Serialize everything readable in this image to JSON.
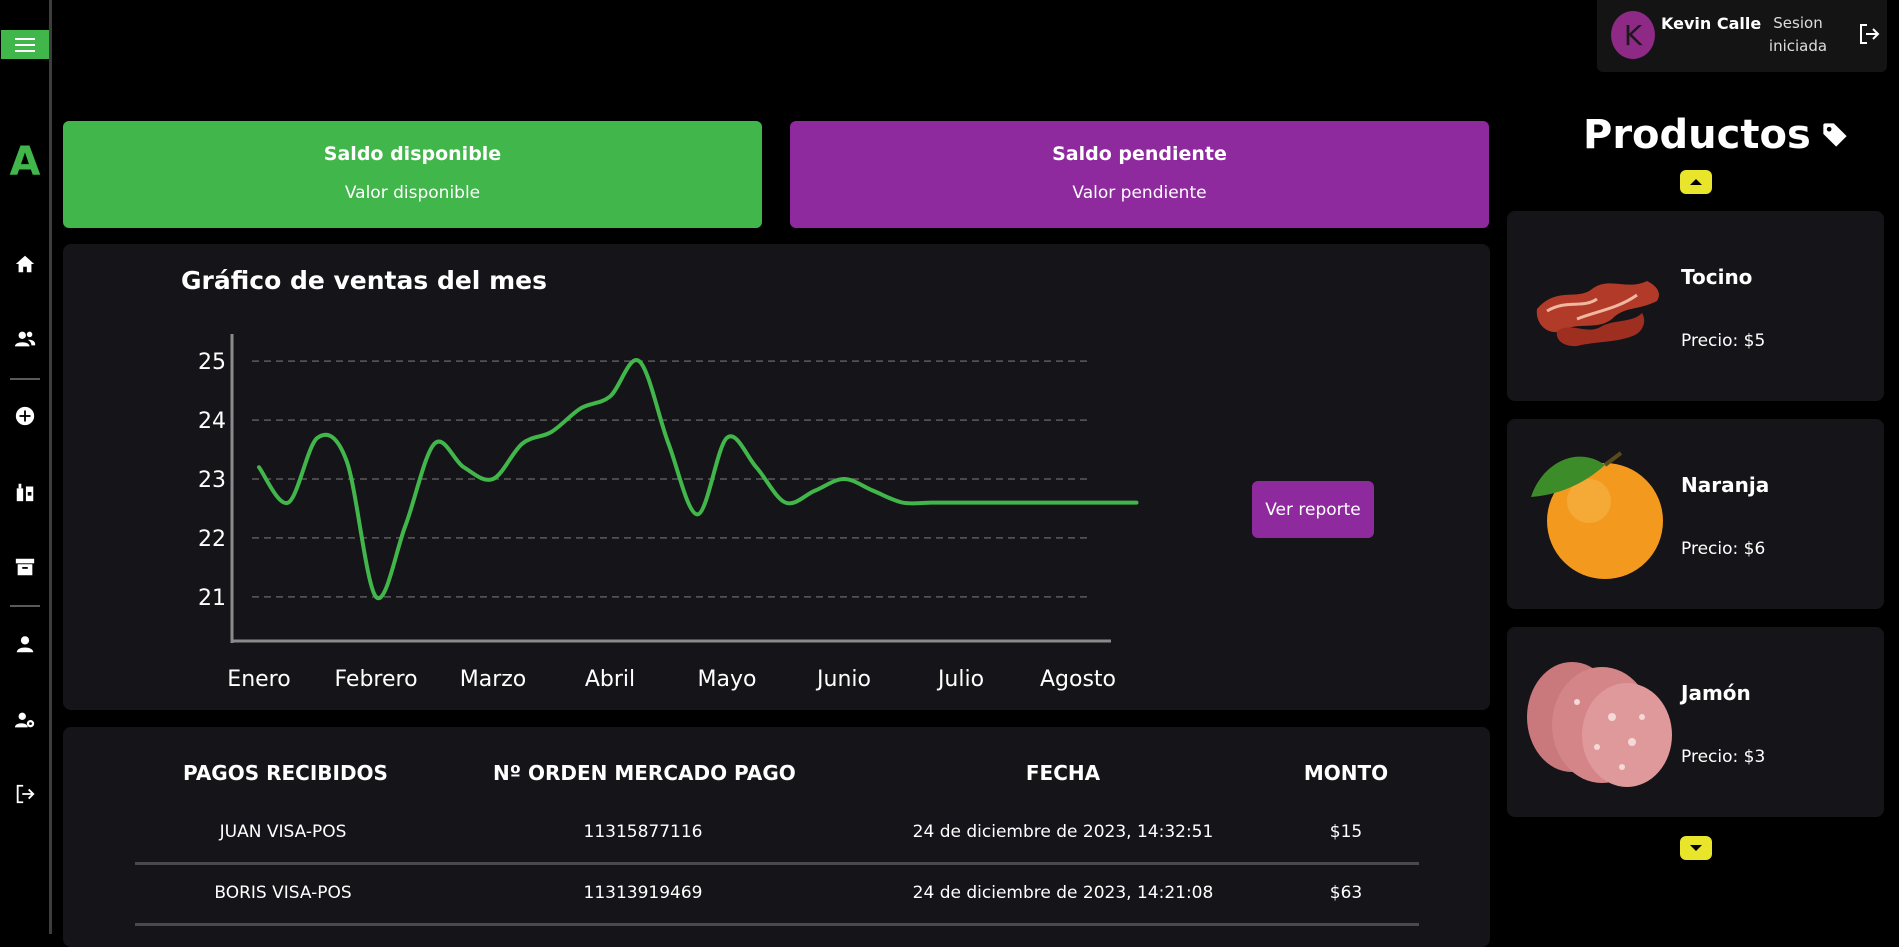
{
  "sidebar": {
    "logo": "A",
    "icons": [
      "menu-icon",
      "home-icon",
      "users-icon",
      "add-circle-icon",
      "inventory-icon",
      "archive-icon",
      "person-icon",
      "user-settings-icon",
      "logout-icon"
    ]
  },
  "user": {
    "initial": "K",
    "name": "Kevin Calle",
    "status": "Sesion iniciada"
  },
  "cards": {
    "available_title": "Saldo disponible",
    "available_value": "Valor disponible",
    "pending_title": "Saldo pendiente",
    "pending_value": "Valor pendiente"
  },
  "chart_panel": {
    "title": "Gráfico de ventas del mes",
    "report_button": "Ver reporte"
  },
  "chart_data": {
    "type": "line",
    "categories": [
      "Enero",
      "Febrero",
      "Marzo",
      "Abril",
      "Mayo",
      "Junio",
      "Julio",
      "Agosto"
    ],
    "x": [
      0,
      0.25,
      0.5,
      0.75,
      1,
      1.25,
      1.5,
      1.75,
      2,
      2.25,
      2.5,
      2.75,
      3,
      3.25,
      3.5,
      3.75,
      4,
      4.25,
      4.5,
      4.75,
      5,
      5.25,
      5.5,
      5.75,
      6,
      6.25,
      6.5,
      6.75,
      7,
      7.25,
      7.5
    ],
    "values": [
      23.2,
      22.6,
      23.7,
      23.3,
      21,
      22.2,
      23.6,
      23.2,
      23,
      23.6,
      23.8,
      24.2,
      24.4,
      25,
      23.6,
      22.4,
      23.7,
      23.2,
      22.6,
      22.8,
      23,
      22.8,
      22.6,
      22.6,
      22.6,
      22.6,
      22.6,
      22.6,
      22.6,
      22.6,
      22.6
    ],
    "yticks": [
      21,
      22,
      23,
      24,
      25
    ],
    "ylim": [
      20.2,
      25.8
    ],
    "color": "#41b64a",
    "grid": "dashed horizontal"
  },
  "table": {
    "headers": [
      "PAGOS RECIBIDOS",
      "Nº ORDEN MERCADO PAGO",
      "FECHA",
      "MONTO"
    ],
    "rows": [
      [
        "JUAN VISA-POS",
        "11315877116",
        "24 de diciembre de 2023, 14:32:51",
        "$15"
      ],
      [
        "BORIS VISA-POS",
        "11313919469",
        "24 de diciembre de 2023, 14:21:08",
        "$63"
      ]
    ]
  },
  "products": {
    "title": "Productos",
    "items": [
      {
        "name": "Tocino",
        "price": "Precio: $5"
      },
      {
        "name": "Naranja",
        "price": "Precio: $6"
      },
      {
        "name": "Jamón",
        "price": "Precio: $3"
      }
    ]
  },
  "colors": {
    "green": "#41b64a",
    "purple": "#8e2a9e",
    "yellow": "#e8e52a",
    "panel": "#151418"
  }
}
